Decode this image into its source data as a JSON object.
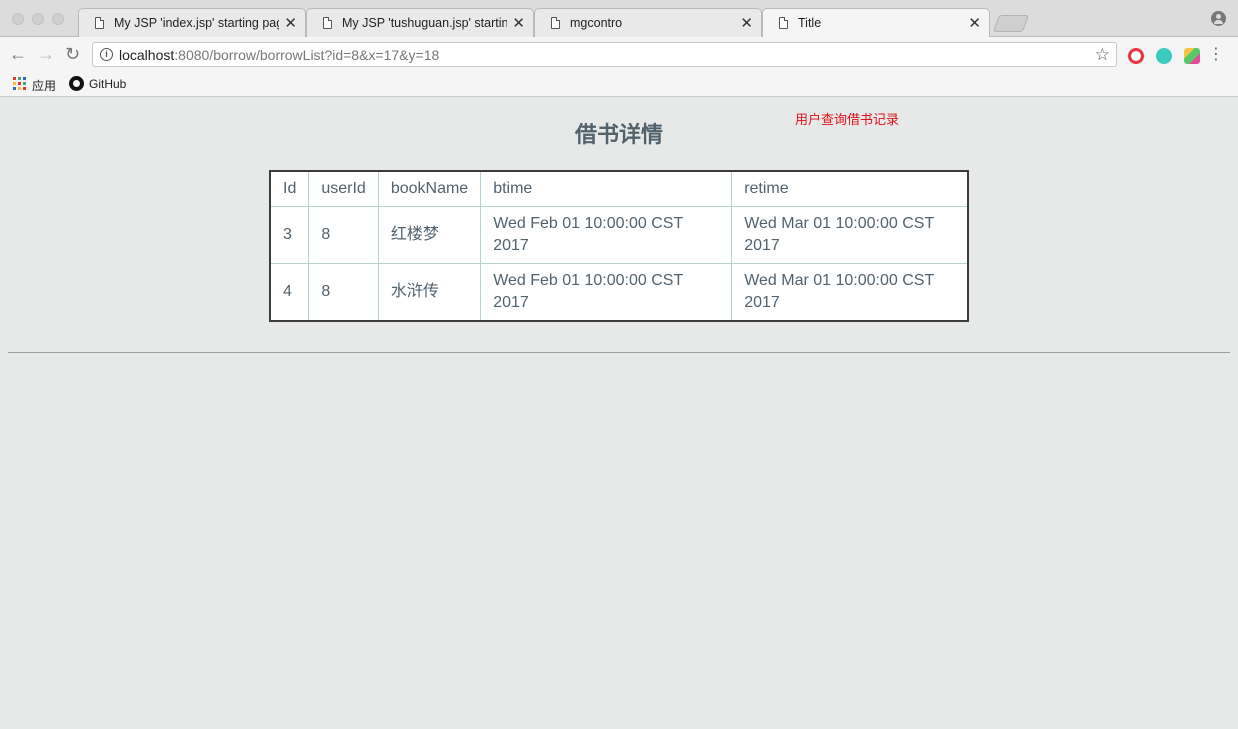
{
  "browser": {
    "tabs": [
      {
        "title": "My JSP 'index.jsp' starting page",
        "active": false
      },
      {
        "title": "My JSP 'tushuguan.jsp' starting page",
        "active": false
      },
      {
        "title": "mgcontro",
        "active": false
      },
      {
        "title": "Title",
        "active": true
      }
    ],
    "address": {
      "host": "localhost",
      "rest": ":8080/borrow/borrowList?id=8&x=17&y=18"
    },
    "bookmarks": {
      "apps_label": "应用",
      "github_label": "GitHub"
    }
  },
  "page": {
    "title": "借书详情",
    "note": "用户查询借书记录",
    "table": {
      "headers": [
        "Id",
        "userId",
        "bookName",
        "btime",
        "retime"
      ],
      "rows": [
        [
          "3",
          "8",
          "红楼梦",
          "Wed Feb 01 10:00:00 CST 2017",
          "Wed Mar 01 10:00:00 CST 2017"
        ],
        [
          "4",
          "8",
          "水浒传",
          "Wed Feb 01 10:00:00 CST 2017",
          "Wed Mar 01 10:00:00 CST 2017"
        ]
      ]
    }
  },
  "colors": {
    "note": "#e0101a",
    "table_text": "#52626d",
    "page_background": "#e6e9e8"
  }
}
